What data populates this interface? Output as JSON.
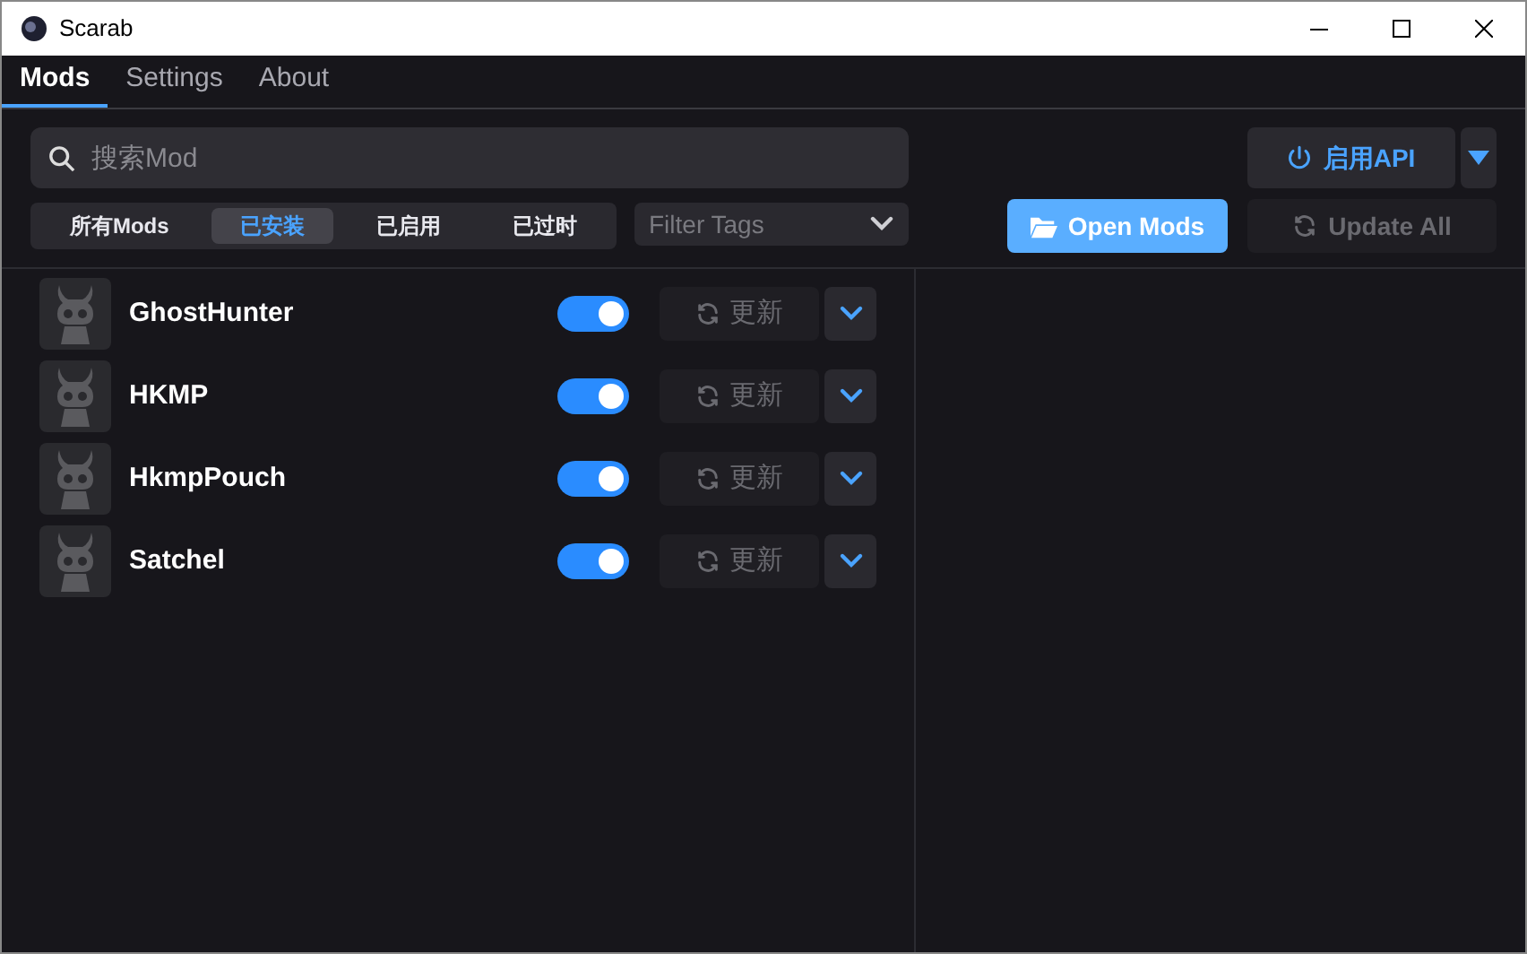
{
  "window": {
    "title": "Scarab"
  },
  "tabs": [
    {
      "label": "Mods",
      "selected": true
    },
    {
      "label": "Settings",
      "selected": false
    },
    {
      "label": "About",
      "selected": false
    }
  ],
  "search": {
    "placeholder": "搜索Mod"
  },
  "filters": [
    {
      "label": "所有Mods",
      "selected": false
    },
    {
      "label": "已安装",
      "selected": true
    },
    {
      "label": "已启用",
      "selected": false
    },
    {
      "label": "已过时",
      "selected": false
    }
  ],
  "tag_filter": {
    "placeholder": "Filter Tags"
  },
  "api_button": {
    "label": "启用API"
  },
  "open_mods_button": {
    "label": "Open Mods"
  },
  "update_all_button": {
    "label": "Update All",
    "disabled": true
  },
  "mods": [
    {
      "name": "GhostHunter",
      "on": true,
      "update_label": "更新"
    },
    {
      "name": "HKMP",
      "on": true,
      "update_label": "更新"
    },
    {
      "name": "HkmpPouch",
      "on": true,
      "update_label": "更新"
    },
    {
      "name": "Satchel",
      "on": true,
      "update_label": "更新"
    }
  ]
}
